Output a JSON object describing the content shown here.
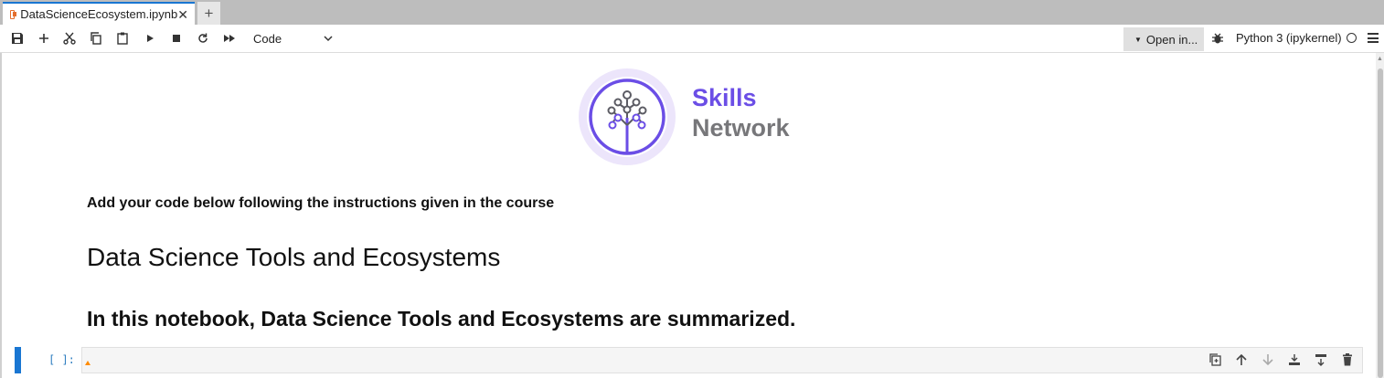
{
  "tabs": [
    {
      "label": "DataScienceEcosystem.ipynb",
      "icon": "notebook-icon",
      "close": "✕"
    }
  ],
  "add_tab_label": "+",
  "toolbar": {
    "buttons": [
      "save-icon",
      "add-cell-icon",
      "cut-icon",
      "copy-icon",
      "paste-icon",
      "run-icon",
      "stop-icon",
      "restart-icon",
      "run-all-icon"
    ],
    "cell_type": "Code",
    "open_in_label": "Open in...",
    "kernel_label": "Python 3 (ipykernel)"
  },
  "notebook": {
    "logo": {
      "line1": "Skills",
      "line2": "Network"
    },
    "instruction_text": "Add your code below following the instructions given in the course",
    "heading1": "Data Science Tools and Ecosystems",
    "heading2": "In this notebook, Data Science Tools and Ecosystems are summarized.",
    "code_cell": {
      "prompt": "[ ]:",
      "value": "",
      "tools": [
        "duplicate-icon",
        "move-up-icon",
        "move-down-icon",
        "insert-above-icon",
        "insert-below-icon",
        "delete-icon"
      ]
    }
  },
  "colors": {
    "accent": "#1976d2",
    "brand_purple": "#6b4ee6",
    "brand_gray": "#77777a"
  }
}
